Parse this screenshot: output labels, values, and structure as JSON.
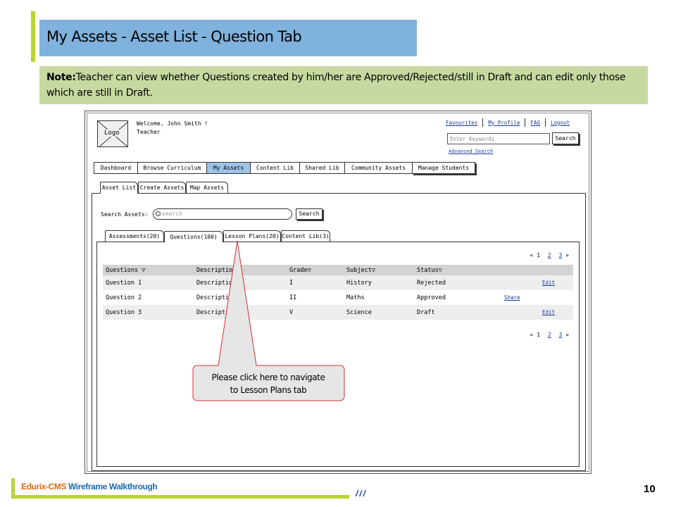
{
  "slide": {
    "title": "My Assets - Asset List  - Question Tab",
    "note_label": "Note:",
    "note_text": "Teacher can view whether Questions created by him/her are Approved/Rejected/still in Draft and can edit only those which are still in Draft.",
    "callout_line1": "Please click here to navigate",
    "callout_line2": "to Lesson Plans tab",
    "footer_brand_1": "Edurix-CMS",
    "footer_brand_2": "Wireframe Walkthrough",
    "footer_slashes": "///",
    "page_number": "10"
  },
  "header": {
    "logo_label": "Logo",
    "welcome": "Welcome, John Smith !",
    "role": "Teacher",
    "links": [
      "Favourites",
      "My Profile",
      "FAQ",
      "Logout"
    ],
    "keywords_placeholder": "Enter Keywords",
    "search_label": "Search",
    "advanced_search": "Advanced Search"
  },
  "nav": {
    "items": [
      "Dashboard",
      "Browse Curriculum",
      "My Assets",
      "Content Lib",
      "Shared Lib",
      "Community Assets",
      "Manage Students"
    ],
    "active": "My Assets"
  },
  "subtabs": {
    "items": [
      "Asset List",
      "Create Assets",
      "Map Assets"
    ],
    "active": "Asset List"
  },
  "search": {
    "label": "Search Assets:",
    "placeholder": "search",
    "button": "Search"
  },
  "asset_tabs": {
    "items": [
      "Assessments(20)",
      "Questions(100)",
      "Lesson Plans(20)",
      "Content Lib(3)"
    ],
    "active": "Questions(100)"
  },
  "pagination": {
    "prev": "«",
    "current": "1",
    "pages": [
      "2",
      "3"
    ],
    "next": "»"
  },
  "table": {
    "headers": [
      "Questions ▽",
      "Description",
      "Grade▽",
      "Subject▽",
      "Status▽"
    ],
    "rows": [
      {
        "question": "Question 1",
        "description": "Description",
        "grade": "I",
        "subject": "History",
        "status": "Rejected",
        "share": "",
        "edit": "Edit"
      },
      {
        "question": "Question 2",
        "description": "Description",
        "grade": "II",
        "subject": "Maths",
        "status": "Approved",
        "share": "Share",
        "edit": ""
      },
      {
        "question": "Question 3",
        "description": "Description",
        "grade": "V",
        "subject": "Science",
        "status": "Draft",
        "share": "",
        "edit": "Edit"
      }
    ]
  },
  "colors": {
    "title_bg": "#7fb2dc",
    "note_bg": "#c6d9a0",
    "accent": "#b8d432",
    "active_nav": "#9dc3e6",
    "callout_border": "#cc3333",
    "callout_fill": "#e6e6e6"
  }
}
